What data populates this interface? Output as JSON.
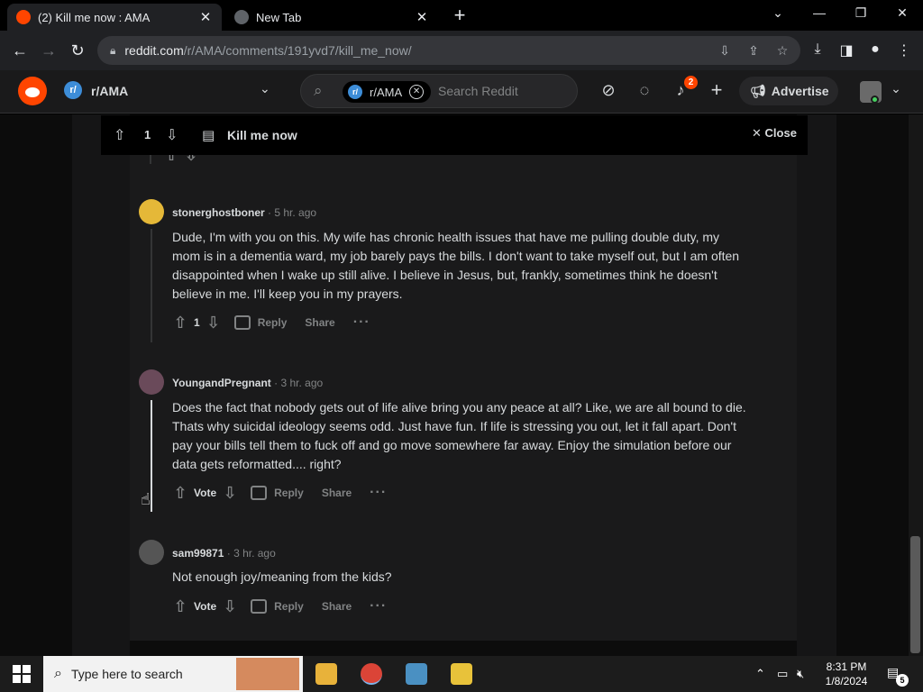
{
  "browser": {
    "tabs": [
      {
        "title": "(2) Kill me now : AMA",
        "active": true
      },
      {
        "title": "New Tab",
        "active": false
      }
    ],
    "url_host": "reddit.com",
    "url_path": "/r/AMA/comments/191yvd7/kill_me_now/"
  },
  "reddit_header": {
    "community": "r/AMA",
    "search_chip": "r/AMA",
    "search_placeholder": "Search Reddit",
    "notification_count": "2",
    "advertise_label": "Advertise"
  },
  "post_bar": {
    "vote_count": "1",
    "title": "Kill me now",
    "close_label": "Close"
  },
  "comments": [
    {
      "user": "stonerghostboner",
      "time": "5 hr. ago",
      "body": "Dude, I'm with you on this. My wife has chronic health issues that have me pulling double duty, my mom is in a dementia ward, my job barely pays the bills. I don't want to take myself out, but I am often disappointed when I wake up still alive. I believe in Jesus, but, frankly, sometimes think he doesn't believe in me. I'll keep you in my prayers.",
      "vote": "1",
      "reply": "Reply",
      "share": "Share"
    },
    {
      "user": "YoungandPregnant",
      "time": "3 hr. ago",
      "body": "Does the fact that nobody gets out of life alive bring you any peace at all? Like, we are all bound to die. Thats why suicidal ideology seems odd. Just have fun. If life is stressing you out, let it fall apart. Don't pay your bills tell them to fuck off and go move somewhere far away. Enjoy the simulation before our data gets reformatted.... right?",
      "vote": "Vote",
      "reply": "Reply",
      "share": "Share"
    },
    {
      "user": "sam99871",
      "time": "3 hr. ago",
      "body": "Not enough joy/meaning from the kids?",
      "vote": "Vote",
      "reply": "Reply",
      "share": "Share"
    }
  ],
  "taskbar": {
    "search_placeholder": "Type here to search",
    "time": "8:31 PM",
    "date": "1/8/2024",
    "notification_count": "5"
  }
}
